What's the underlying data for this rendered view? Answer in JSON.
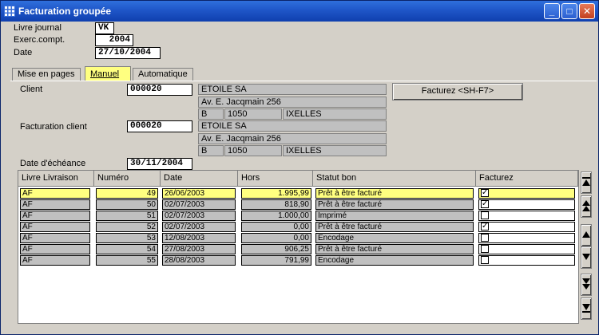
{
  "window": {
    "title": "Facturation groupée"
  },
  "header": {
    "livre_journal_label": "Livre journal",
    "livre_journal_value": "VK",
    "exerc_label": "Exerc.compt.",
    "exerc_value": "2004",
    "date_label": "Date",
    "date_value": "27/10/2004"
  },
  "tabs": [
    {
      "label": "Mise en pages",
      "active": false
    },
    {
      "label": "Manuel",
      "active": true
    },
    {
      "label": "Automatique",
      "active": false
    }
  ],
  "client": {
    "label": "Client",
    "code": "000020",
    "name": "ETOILE SA",
    "address": "Av. E. Jacqmain 256",
    "country": "B",
    "postal": "1050",
    "city": "IXELLES"
  },
  "billing_client": {
    "label": "Facturation client",
    "code": "000020",
    "name": "ETOILE SA",
    "address": "Av. E. Jacqmain 256",
    "country": "B",
    "postal": "1050",
    "city": "IXELLES"
  },
  "due_date": {
    "label": "Date d'échéance",
    "value": "30/11/2004"
  },
  "invoice_button": {
    "label": "Facturez <SH-F7>"
  },
  "table": {
    "columns": [
      "Livre Livraison",
      "Numéro",
      "Date",
      "Hors",
      "Statut bon",
      "Facturez"
    ],
    "rows": [
      {
        "livre": "AF",
        "numero": "49",
        "date": "26/06/2003",
        "hors": "1.995,99",
        "statut": "Prêt à être facturé",
        "facturez": true,
        "selected": true
      },
      {
        "livre": "AF",
        "numero": "50",
        "date": "02/07/2003",
        "hors": "818,90",
        "statut": "Prêt à être facturé",
        "facturez": true,
        "selected": false
      },
      {
        "livre": "AF",
        "numero": "51",
        "date": "02/07/2003",
        "hors": "1.000,00",
        "statut": "Imprimé",
        "facturez": false,
        "selected": false
      },
      {
        "livre": "AF",
        "numero": "52",
        "date": "02/07/2003",
        "hors": "0,00",
        "statut": "Prêt à être facturé",
        "facturez": true,
        "selected": false
      },
      {
        "livre": "AF",
        "numero": "53",
        "date": "12/08/2003",
        "hors": "0,00",
        "statut": "Encodage",
        "facturez": false,
        "selected": false
      },
      {
        "livre": "AF",
        "numero": "54",
        "date": "27/08/2003",
        "hors": "906,25",
        "statut": "Prêt à être facturé",
        "facturez": false,
        "selected": false
      },
      {
        "livre": "AF",
        "numero": "55",
        "date": "28/08/2003",
        "hors": "791,99",
        "statut": "Encodage",
        "facturez": false,
        "selected": false
      }
    ]
  },
  "colors": {
    "titlebar": "#1f56c8",
    "highlight": "#ffff80",
    "panel": "#d4d0c8"
  }
}
